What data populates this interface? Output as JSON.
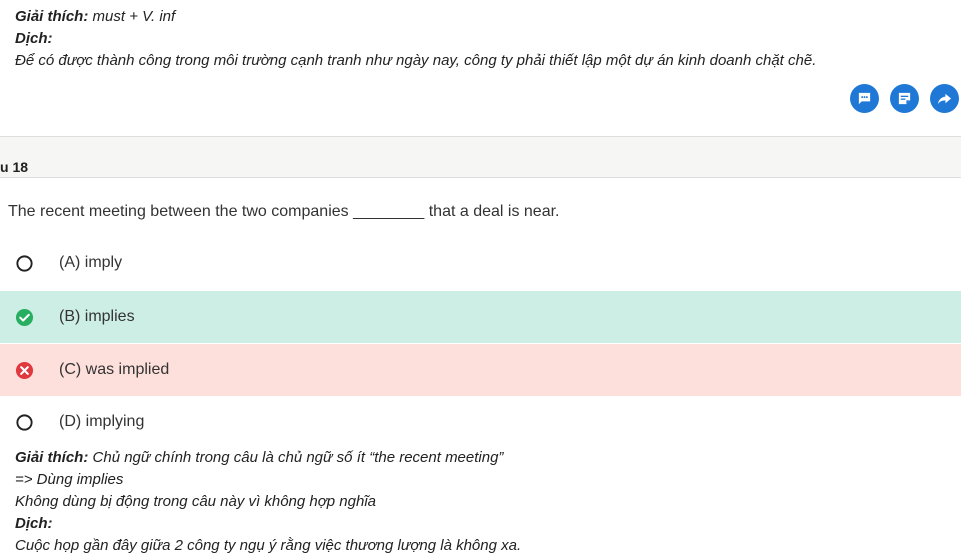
{
  "top_explanation": {
    "label_explain": "Giải thích:",
    "explain_text": "must + V. inf",
    "label_translate": "Dịch:",
    "translate_text": "Để có được thành công trong môi trường cạnh tranh như ngày nay, công ty phải thiết lập một dự án kinh doanh chặt chẽ."
  },
  "actions": [
    {
      "icon": "comment-icon"
    },
    {
      "icon": "note-icon"
    },
    {
      "icon": "share-icon"
    }
  ],
  "question_header": {
    "title": "u 18"
  },
  "question": {
    "text": "The recent meeting between the two companies ________ that a deal is near."
  },
  "options": [
    {
      "label": "(A) imply",
      "state": "unselected"
    },
    {
      "label": "(B) implies",
      "state": "correct"
    },
    {
      "label": "(C) was implied",
      "state": "wrong"
    },
    {
      "label": "(D) implying",
      "state": "unselected"
    }
  ],
  "bottom_explanation": {
    "label_explain": "Giải thích:",
    "explain_line1": "Chủ ngữ chính trong câu là chủ ngữ số ít “the recent meeting”",
    "explain_line2": "=> Dùng implies",
    "explain_line3": "Không dùng bị động trong câu này vì không hợp nghĩa",
    "label_translate": "Dịch:",
    "translate_text": "Cuộc họp gần đây giữa 2 công ty ngụ ý rằng việc thương lượng là không xa."
  },
  "colors": {
    "accent": "#1f78d6",
    "correct_bg": "#cdeee4",
    "correct_icon": "#27ae60",
    "wrong_bg": "#fde0dc",
    "wrong_icon": "#e0383e"
  }
}
